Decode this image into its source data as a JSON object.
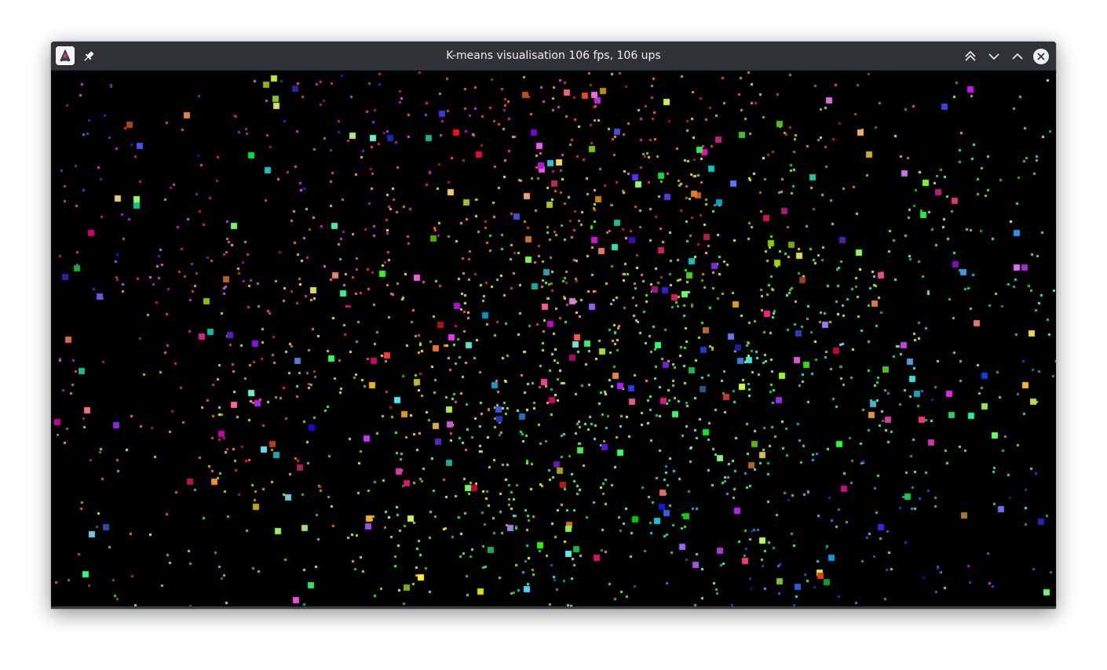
{
  "window": {
    "title": "K-means visualisation 106 fps, 106 ups"
  },
  "titlebar": {
    "app_icon": "java-app-icon",
    "pin_icon": "pin-icon",
    "buttons": [
      {
        "name": "keep-above-button",
        "icon": "double-chevron-up-icon"
      },
      {
        "name": "keep-below-button",
        "icon": "chevron-down-icon"
      },
      {
        "name": "maximize-button",
        "icon": "chevron-up-icon"
      },
      {
        "name": "close-button",
        "icon": "close-circle-icon"
      }
    ]
  },
  "colors": {
    "titlebar_bg": "#2f3338",
    "title_text": "#eff0f1",
    "canvas_bg": "#000000"
  },
  "canvas": {
    "content": "k-means point cloud visualisation",
    "point_count_estimate": 30000,
    "centroid_count_estimate": 380
  }
}
